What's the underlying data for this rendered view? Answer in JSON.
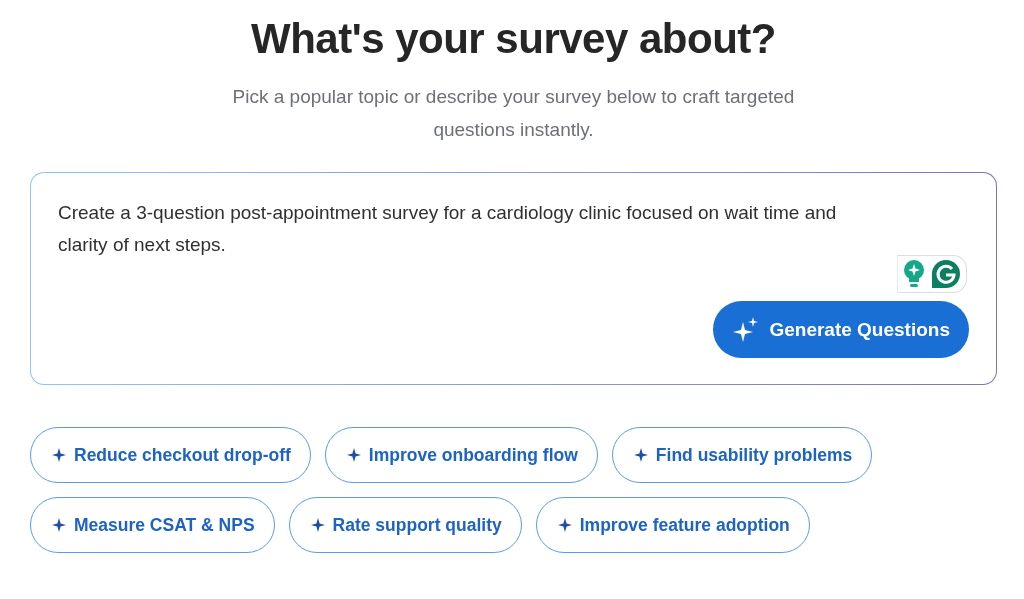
{
  "heading": "What's your survey about?",
  "subtitle": "Pick a popular topic or describe your survey below to craft targeted questions instantly.",
  "prompt": {
    "value": "Create a 3-question post-appointment survey for a cardiology clinic focused on wait time and clarity of next steps."
  },
  "generate_button": "Generate Questions",
  "topics": [
    {
      "label": "Reduce checkout drop-off"
    },
    {
      "label": "Improve onboarding flow"
    },
    {
      "label": "Find usability problems"
    },
    {
      "label": "Measure CSAT & NPS"
    },
    {
      "label": "Rate support quality"
    },
    {
      "label": "Improve feature adoption"
    }
  ]
}
